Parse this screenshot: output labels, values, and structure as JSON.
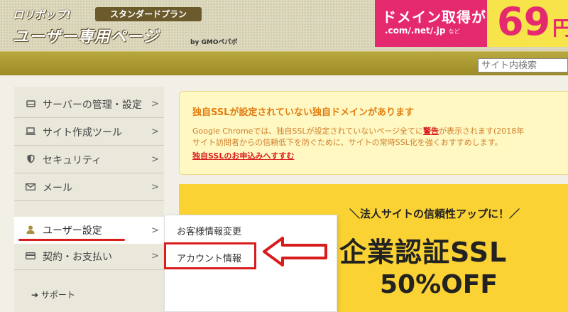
{
  "header": {
    "brand": "ロリポップ!",
    "plan": "スタンダードプラン",
    "portal_title": "ユーザー専用ページ",
    "gmo": "by GMOペパボ"
  },
  "promo": {
    "title": "ドメイン取得が",
    "tlds": ".com/.net/.jp",
    "suffix": "など",
    "price": "69",
    "unit": "円"
  },
  "search": {
    "placeholder": "サイト内検索"
  },
  "sidebar": {
    "items": [
      {
        "label": "サーバーの管理・設定",
        "icon": "server-icon"
      },
      {
        "label": "サイト作成ツール",
        "icon": "laptop-icon"
      },
      {
        "label": "セキュリティ",
        "icon": "shield-icon"
      },
      {
        "label": "メール",
        "icon": "mail-icon"
      },
      {
        "label": "ユーザー設定",
        "icon": "user-icon",
        "active": true
      },
      {
        "label": "契約・お支払い",
        "icon": "card-icon"
      }
    ],
    "support": "サポート"
  },
  "dropdown": {
    "items": [
      "お客様情報変更",
      "アカウント情報"
    ]
  },
  "alert": {
    "title": "独自SSLが設定されていない独自ドメインがあります",
    "body_line1_a": "Google Chromeでは、独自SSLが設定されていないページ全てに",
    "body_line1_link": "警告",
    "body_line1_b": "が表示されます(2018年",
    "body_line2": "サイト訪問者からの信頼低下を防ぐために、サイトの常時SSL化を強くおすすめします。",
    "cta": "独自SSLのお申込みへすすむ"
  },
  "ssl_banner": {
    "tagline": "＼法人サイトの信頼性アップに！／",
    "headline": "企業認証SSL",
    "discount": "50%OFF"
  },
  "colors": {
    "accent_red": "#d91c1c",
    "olive": "#9c8a26",
    "banner_yellow": "#fbd233",
    "promo_pink": "#e5296e"
  }
}
